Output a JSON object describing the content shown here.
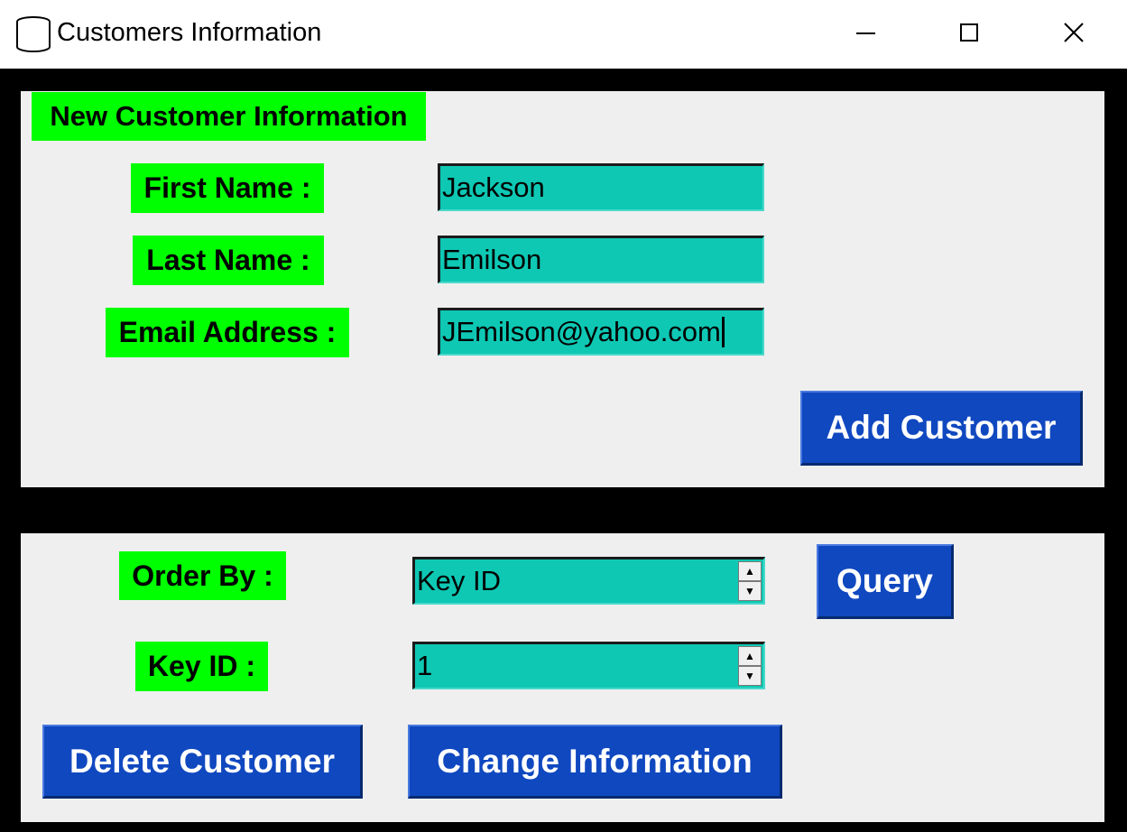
{
  "window": {
    "title": "Customers Information",
    "icon": "database-icon",
    "controls": [
      "minimize-icon",
      "maximize-icon",
      "close-icon"
    ]
  },
  "new_customer": {
    "section_label": "New Customer Information",
    "first_name_label": "First Name :",
    "first_name_value": "Jackson",
    "last_name_label": "Last Name :",
    "last_name_value": "Emilson",
    "email_label": "Email Address :",
    "email_value": "JEmilson@yahoo.com",
    "add_button": "Add Customer"
  },
  "query": {
    "order_by_label": "Order By :",
    "order_by_value": "Key ID",
    "query_button": "Query",
    "key_id_label": "Key ID :",
    "key_id_value": "1",
    "delete_button": "Delete Customer",
    "change_button": "Change Information"
  },
  "colors": {
    "window_bg": "#000000",
    "panel_bg": "#efefef",
    "label_bg": "#00ff00",
    "entry_bg": "#0ec8b4",
    "button_bg": "#1048c0",
    "button_text": "#ffffff"
  }
}
